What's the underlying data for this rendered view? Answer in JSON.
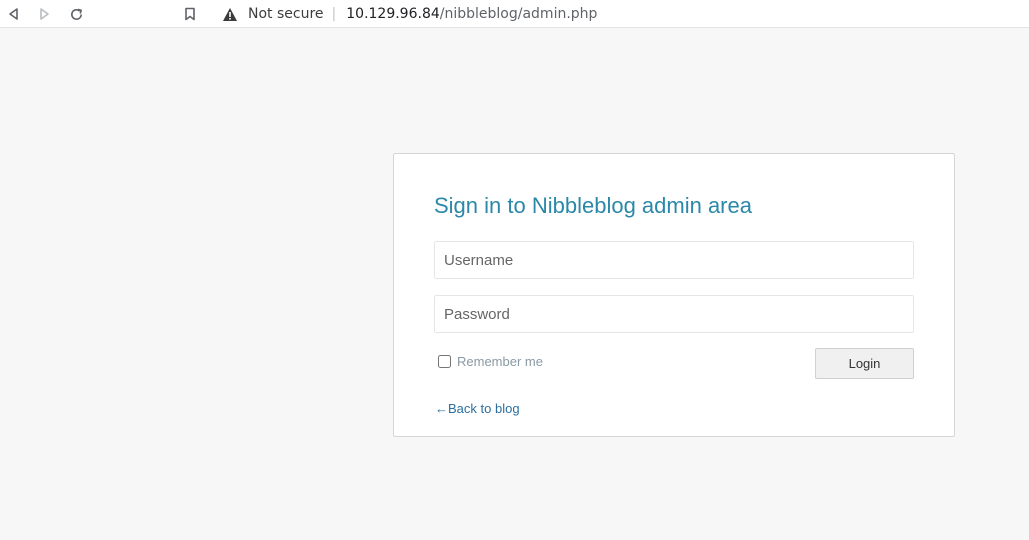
{
  "browser": {
    "security_label": "Not secure",
    "url_host": "10.129.96.84",
    "url_path": "/nibbleblog/admin.php",
    "icons": [
      "back-icon",
      "forward-icon",
      "reload-icon",
      "bookmark-icon",
      "warning-icon"
    ]
  },
  "login": {
    "title": "Sign in to Nibbleblog admin area",
    "username_placeholder": "Username",
    "password_placeholder": "Password",
    "remember_label": "Remember me",
    "login_label": "Login",
    "back_label": "←Back to blog"
  },
  "colors": {
    "title": "#2b88a8",
    "link": "#2b6fa0",
    "page_bg": "#f7f7f7"
  }
}
